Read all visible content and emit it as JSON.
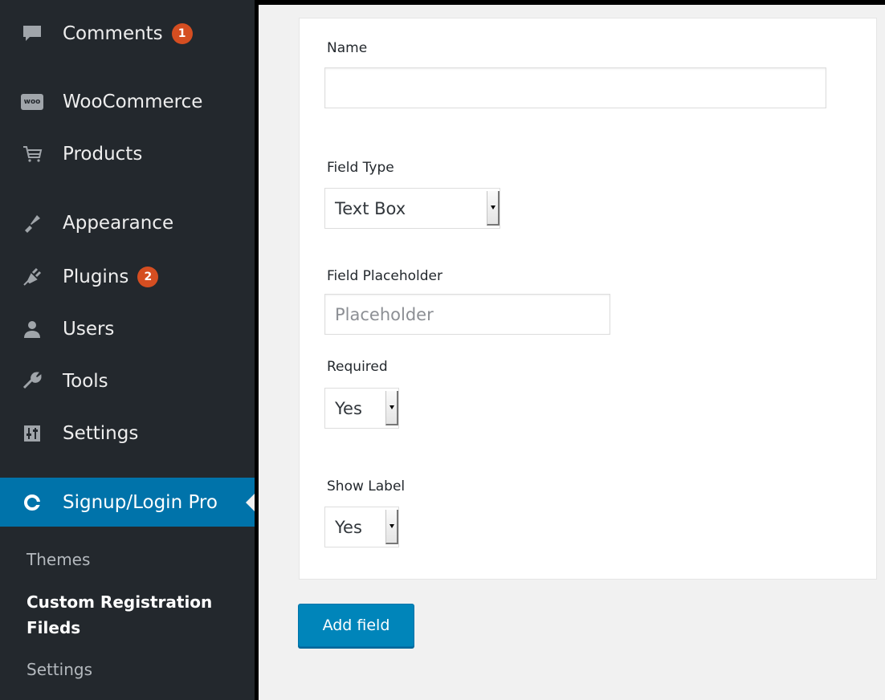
{
  "sidebar": {
    "items": [
      {
        "label": "Comments",
        "icon": "comment-icon",
        "badge": "1"
      },
      {
        "label": "WooCommerce",
        "icon": "woocommerce-icon",
        "icon_text": "woo"
      },
      {
        "label": "Products",
        "icon": "cart-icon"
      },
      {
        "label": "Appearance",
        "icon": "paintbrush-icon"
      },
      {
        "label": "Plugins",
        "icon": "plugin-icon",
        "badge": "2"
      },
      {
        "label": "Users",
        "icon": "user-icon"
      },
      {
        "label": "Tools",
        "icon": "wrench-icon"
      },
      {
        "label": "Settings",
        "icon": "settings-sliders-icon"
      }
    ],
    "active": {
      "label": "Signup/Login Pro",
      "icon": "signup-login-icon"
    },
    "submenu": [
      {
        "label": "Themes"
      },
      {
        "label": "Custom Registration Fileds"
      },
      {
        "label": "Settings"
      }
    ]
  },
  "form": {
    "name_label": "Name",
    "name_value": "",
    "field_type_label": "Field Type",
    "field_type_value": "Text Box",
    "placeholder_label": "Field Placeholder",
    "placeholder_hint": "Placeholder",
    "required_label": "Required",
    "required_value": "Yes",
    "show_label_label": "Show Label",
    "show_label_value": "Yes",
    "add_button": "Add field"
  },
  "colors": {
    "sidebar_bg": "#23282d",
    "active_bg": "#0073aa",
    "badge_bg": "#d54e21",
    "button_bg": "#0085ba"
  }
}
